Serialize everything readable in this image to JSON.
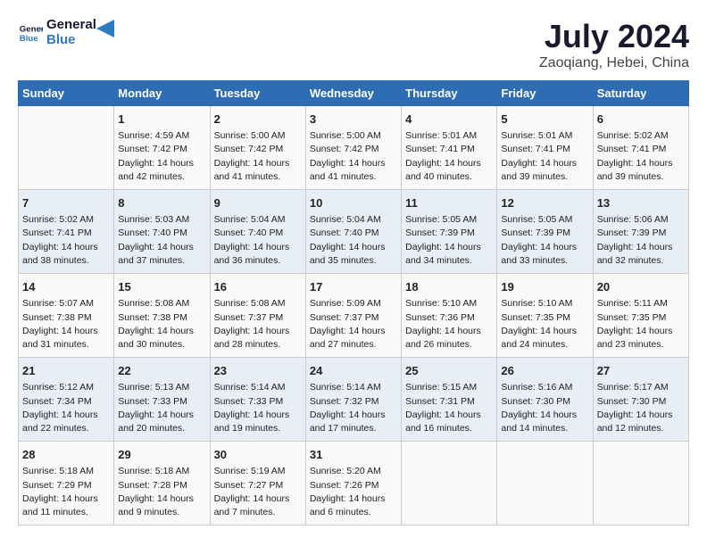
{
  "logo": {
    "line1": "General",
    "line2": "Blue"
  },
  "title": "July 2024",
  "subtitle": "Zaoqiang, Hebei, China",
  "days_header": [
    "Sunday",
    "Monday",
    "Tuesday",
    "Wednesday",
    "Thursday",
    "Friday",
    "Saturday"
  ],
  "weeks": [
    [
      {
        "day": "",
        "sunrise": "",
        "sunset": "",
        "daylight": ""
      },
      {
        "day": "1",
        "sunrise": "Sunrise: 4:59 AM",
        "sunset": "Sunset: 7:42 PM",
        "daylight": "Daylight: 14 hours and 42 minutes."
      },
      {
        "day": "2",
        "sunrise": "Sunrise: 5:00 AM",
        "sunset": "Sunset: 7:42 PM",
        "daylight": "Daylight: 14 hours and 41 minutes."
      },
      {
        "day": "3",
        "sunrise": "Sunrise: 5:00 AM",
        "sunset": "Sunset: 7:42 PM",
        "daylight": "Daylight: 14 hours and 41 minutes."
      },
      {
        "day": "4",
        "sunrise": "Sunrise: 5:01 AM",
        "sunset": "Sunset: 7:41 PM",
        "daylight": "Daylight: 14 hours and 40 minutes."
      },
      {
        "day": "5",
        "sunrise": "Sunrise: 5:01 AM",
        "sunset": "Sunset: 7:41 PM",
        "daylight": "Daylight: 14 hours and 39 minutes."
      },
      {
        "day": "6",
        "sunrise": "Sunrise: 5:02 AM",
        "sunset": "Sunset: 7:41 PM",
        "daylight": "Daylight: 14 hours and 39 minutes."
      }
    ],
    [
      {
        "day": "7",
        "sunrise": "Sunrise: 5:02 AM",
        "sunset": "Sunset: 7:41 PM",
        "daylight": "Daylight: 14 hours and 38 minutes."
      },
      {
        "day": "8",
        "sunrise": "Sunrise: 5:03 AM",
        "sunset": "Sunset: 7:40 PM",
        "daylight": "Daylight: 14 hours and 37 minutes."
      },
      {
        "day": "9",
        "sunrise": "Sunrise: 5:04 AM",
        "sunset": "Sunset: 7:40 PM",
        "daylight": "Daylight: 14 hours and 36 minutes."
      },
      {
        "day": "10",
        "sunrise": "Sunrise: 5:04 AM",
        "sunset": "Sunset: 7:40 PM",
        "daylight": "Daylight: 14 hours and 35 minutes."
      },
      {
        "day": "11",
        "sunrise": "Sunrise: 5:05 AM",
        "sunset": "Sunset: 7:39 PM",
        "daylight": "Daylight: 14 hours and 34 minutes."
      },
      {
        "day": "12",
        "sunrise": "Sunrise: 5:05 AM",
        "sunset": "Sunset: 7:39 PM",
        "daylight": "Daylight: 14 hours and 33 minutes."
      },
      {
        "day": "13",
        "sunrise": "Sunrise: 5:06 AM",
        "sunset": "Sunset: 7:39 PM",
        "daylight": "Daylight: 14 hours and 32 minutes."
      }
    ],
    [
      {
        "day": "14",
        "sunrise": "Sunrise: 5:07 AM",
        "sunset": "Sunset: 7:38 PM",
        "daylight": "Daylight: 14 hours and 31 minutes."
      },
      {
        "day": "15",
        "sunrise": "Sunrise: 5:08 AM",
        "sunset": "Sunset: 7:38 PM",
        "daylight": "Daylight: 14 hours and 30 minutes."
      },
      {
        "day": "16",
        "sunrise": "Sunrise: 5:08 AM",
        "sunset": "Sunset: 7:37 PM",
        "daylight": "Daylight: 14 hours and 28 minutes."
      },
      {
        "day": "17",
        "sunrise": "Sunrise: 5:09 AM",
        "sunset": "Sunset: 7:37 PM",
        "daylight": "Daylight: 14 hours and 27 minutes."
      },
      {
        "day": "18",
        "sunrise": "Sunrise: 5:10 AM",
        "sunset": "Sunset: 7:36 PM",
        "daylight": "Daylight: 14 hours and 26 minutes."
      },
      {
        "day": "19",
        "sunrise": "Sunrise: 5:10 AM",
        "sunset": "Sunset: 7:35 PM",
        "daylight": "Daylight: 14 hours and 24 minutes."
      },
      {
        "day": "20",
        "sunrise": "Sunrise: 5:11 AM",
        "sunset": "Sunset: 7:35 PM",
        "daylight": "Daylight: 14 hours and 23 minutes."
      }
    ],
    [
      {
        "day": "21",
        "sunrise": "Sunrise: 5:12 AM",
        "sunset": "Sunset: 7:34 PM",
        "daylight": "Daylight: 14 hours and 22 minutes."
      },
      {
        "day": "22",
        "sunrise": "Sunrise: 5:13 AM",
        "sunset": "Sunset: 7:33 PM",
        "daylight": "Daylight: 14 hours and 20 minutes."
      },
      {
        "day": "23",
        "sunrise": "Sunrise: 5:14 AM",
        "sunset": "Sunset: 7:33 PM",
        "daylight": "Daylight: 14 hours and 19 minutes."
      },
      {
        "day": "24",
        "sunrise": "Sunrise: 5:14 AM",
        "sunset": "Sunset: 7:32 PM",
        "daylight": "Daylight: 14 hours and 17 minutes."
      },
      {
        "day": "25",
        "sunrise": "Sunrise: 5:15 AM",
        "sunset": "Sunset: 7:31 PM",
        "daylight": "Daylight: 14 hours and 16 minutes."
      },
      {
        "day": "26",
        "sunrise": "Sunrise: 5:16 AM",
        "sunset": "Sunset: 7:30 PM",
        "daylight": "Daylight: 14 hours and 14 minutes."
      },
      {
        "day": "27",
        "sunrise": "Sunrise: 5:17 AM",
        "sunset": "Sunset: 7:30 PM",
        "daylight": "Daylight: 14 hours and 12 minutes."
      }
    ],
    [
      {
        "day": "28",
        "sunrise": "Sunrise: 5:18 AM",
        "sunset": "Sunset: 7:29 PM",
        "daylight": "Daylight: 14 hours and 11 minutes."
      },
      {
        "day": "29",
        "sunrise": "Sunrise: 5:18 AM",
        "sunset": "Sunset: 7:28 PM",
        "daylight": "Daylight: 14 hours and 9 minutes."
      },
      {
        "day": "30",
        "sunrise": "Sunrise: 5:19 AM",
        "sunset": "Sunset: 7:27 PM",
        "daylight": "Daylight: 14 hours and 7 minutes."
      },
      {
        "day": "31",
        "sunrise": "Sunrise: 5:20 AM",
        "sunset": "Sunset: 7:26 PM",
        "daylight": "Daylight: 14 hours and 6 minutes."
      },
      {
        "day": "",
        "sunrise": "",
        "sunset": "",
        "daylight": ""
      },
      {
        "day": "",
        "sunrise": "",
        "sunset": "",
        "daylight": ""
      },
      {
        "day": "",
        "sunrise": "",
        "sunset": "",
        "daylight": ""
      }
    ]
  ]
}
